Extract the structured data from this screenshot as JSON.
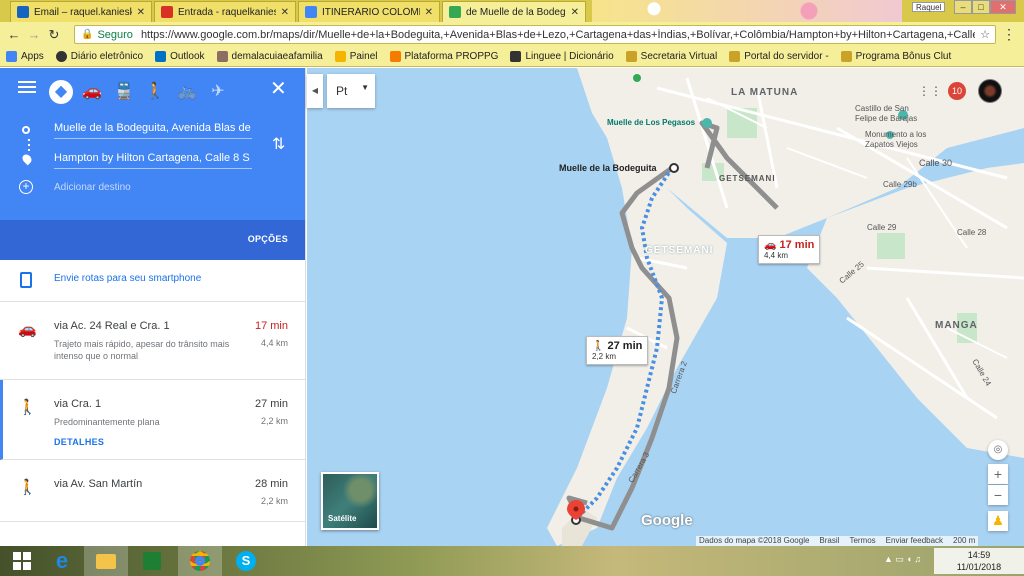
{
  "browser": {
    "tabs": [
      {
        "title": "Email – raquel.kanieski@",
        "color": "#1565c0"
      },
      {
        "title": "Entrada - raquelkanieski",
        "color": "#d93025"
      },
      {
        "title": "ITINERÁRIO COLÔMBIA",
        "color": "#4285f4"
      },
      {
        "title": "de Muelle de la Bodeguita",
        "color": "#34a853"
      }
    ],
    "profile": "Raquel",
    "secure_label": "Seguro",
    "url": "https://www.google.com.br/maps/dir/Muelle+de+la+Bodeguita,+Avenida+Blas+de+Lezo,+Cartagena+das+Índias,+Bolívar,+Colômbia/Hampton+by+Hilton+Cartagena,+Calle+8...",
    "bookmarks": [
      {
        "label": "Apps",
        "color": "#4285f4"
      },
      {
        "label": "Diário eletrônico",
        "color": "#333333"
      },
      {
        "label": "Outlook",
        "color": "#0072c6"
      },
      {
        "label": "demalacuiaeafamilia",
        "color": "#8d6e63"
      },
      {
        "label": "Painel",
        "color": "#f4b400"
      },
      {
        "label": "Plataforma PROPPG",
        "color": "#f57c00"
      },
      {
        "label": "Linguee | Dicionário",
        "color": "#333333"
      },
      {
        "label": "Secretaria Virtual",
        "color": "#c9a227"
      },
      {
        "label": "Portal do servidor - ",
        "color": "#c9a227"
      },
      {
        "label": "Programa Bônus Clut",
        "color": "#c9a227"
      }
    ]
  },
  "directions": {
    "origin": "Muelle de la Bodeguita, Avenida Blas de Lezo",
    "destination": "Hampton by Hilton Cartagena, Calle 8 S",
    "add_destination": "Adicionar destino",
    "options_label": "OPÇÕES",
    "send_label": "Envie rotas para seu smartphone",
    "routes": [
      {
        "mode_icon": "car-icon",
        "via": "via Ac. 24 Real e Cra. 1",
        "desc": "Trajeto mais rápido, apesar do trânsito mais intenso que o normal",
        "time": "17 min",
        "dist": "4,4 km",
        "details": ""
      },
      {
        "mode_icon": "walk-icon",
        "via": "via Cra. 1",
        "desc": "Predominantemente plana",
        "time": "27 min",
        "dist": "2,2 km",
        "details": "DETALHES"
      },
      {
        "mode_icon": "walk-icon",
        "via": "via Av. San Martín",
        "desc": "",
        "time": "28 min",
        "dist": "2,2 km",
        "details": ""
      }
    ]
  },
  "map": {
    "lang": "Pt",
    "labels": {
      "la_matuna": "LA MATUNA",
      "getsemani_main": "GETSEMANI",
      "getsemani_small": "GETSEMANI",
      "manga": "MANGA",
      "castillo": "Castillo de San Felipe de Barajas",
      "monumento": "Monumento a los Zapatos Viejos",
      "muelle_pegasos": "Muelle de Los Pegasos",
      "muelle_bodeguita": "Muelle de la Bodeguita",
      "calle_30": "Calle 30",
      "calle_29b": "Calle 29b",
      "calle_29": "Calle 29",
      "calle_28": "Calle 28",
      "calle_25": "Calle 25",
      "carrera_2": "Carrera 2",
      "carrera_3": "Carrera 3",
      "calle_24": "Calle 24"
    },
    "car_bubble": {
      "time": "17 min",
      "dist": "4,4 km"
    },
    "walk_bubble": {
      "time": "27 min",
      "dist": "2,2 km"
    },
    "satellite_label": "Satélite",
    "notifications": "10",
    "google": "Google",
    "footer": [
      "Dados do mapa ©2018 Google",
      "Brasil",
      "Termos",
      "Enviar feedback",
      "200 m"
    ],
    "colors": {
      "water": "#a9d3f3",
      "land": "#f2efe9",
      "route_walk": "#4a90e2",
      "route_car": "#8f8f8f",
      "park": "#c8e6c9"
    }
  },
  "taskbar": {
    "time": "14:59",
    "date": "11/01/2018"
  }
}
